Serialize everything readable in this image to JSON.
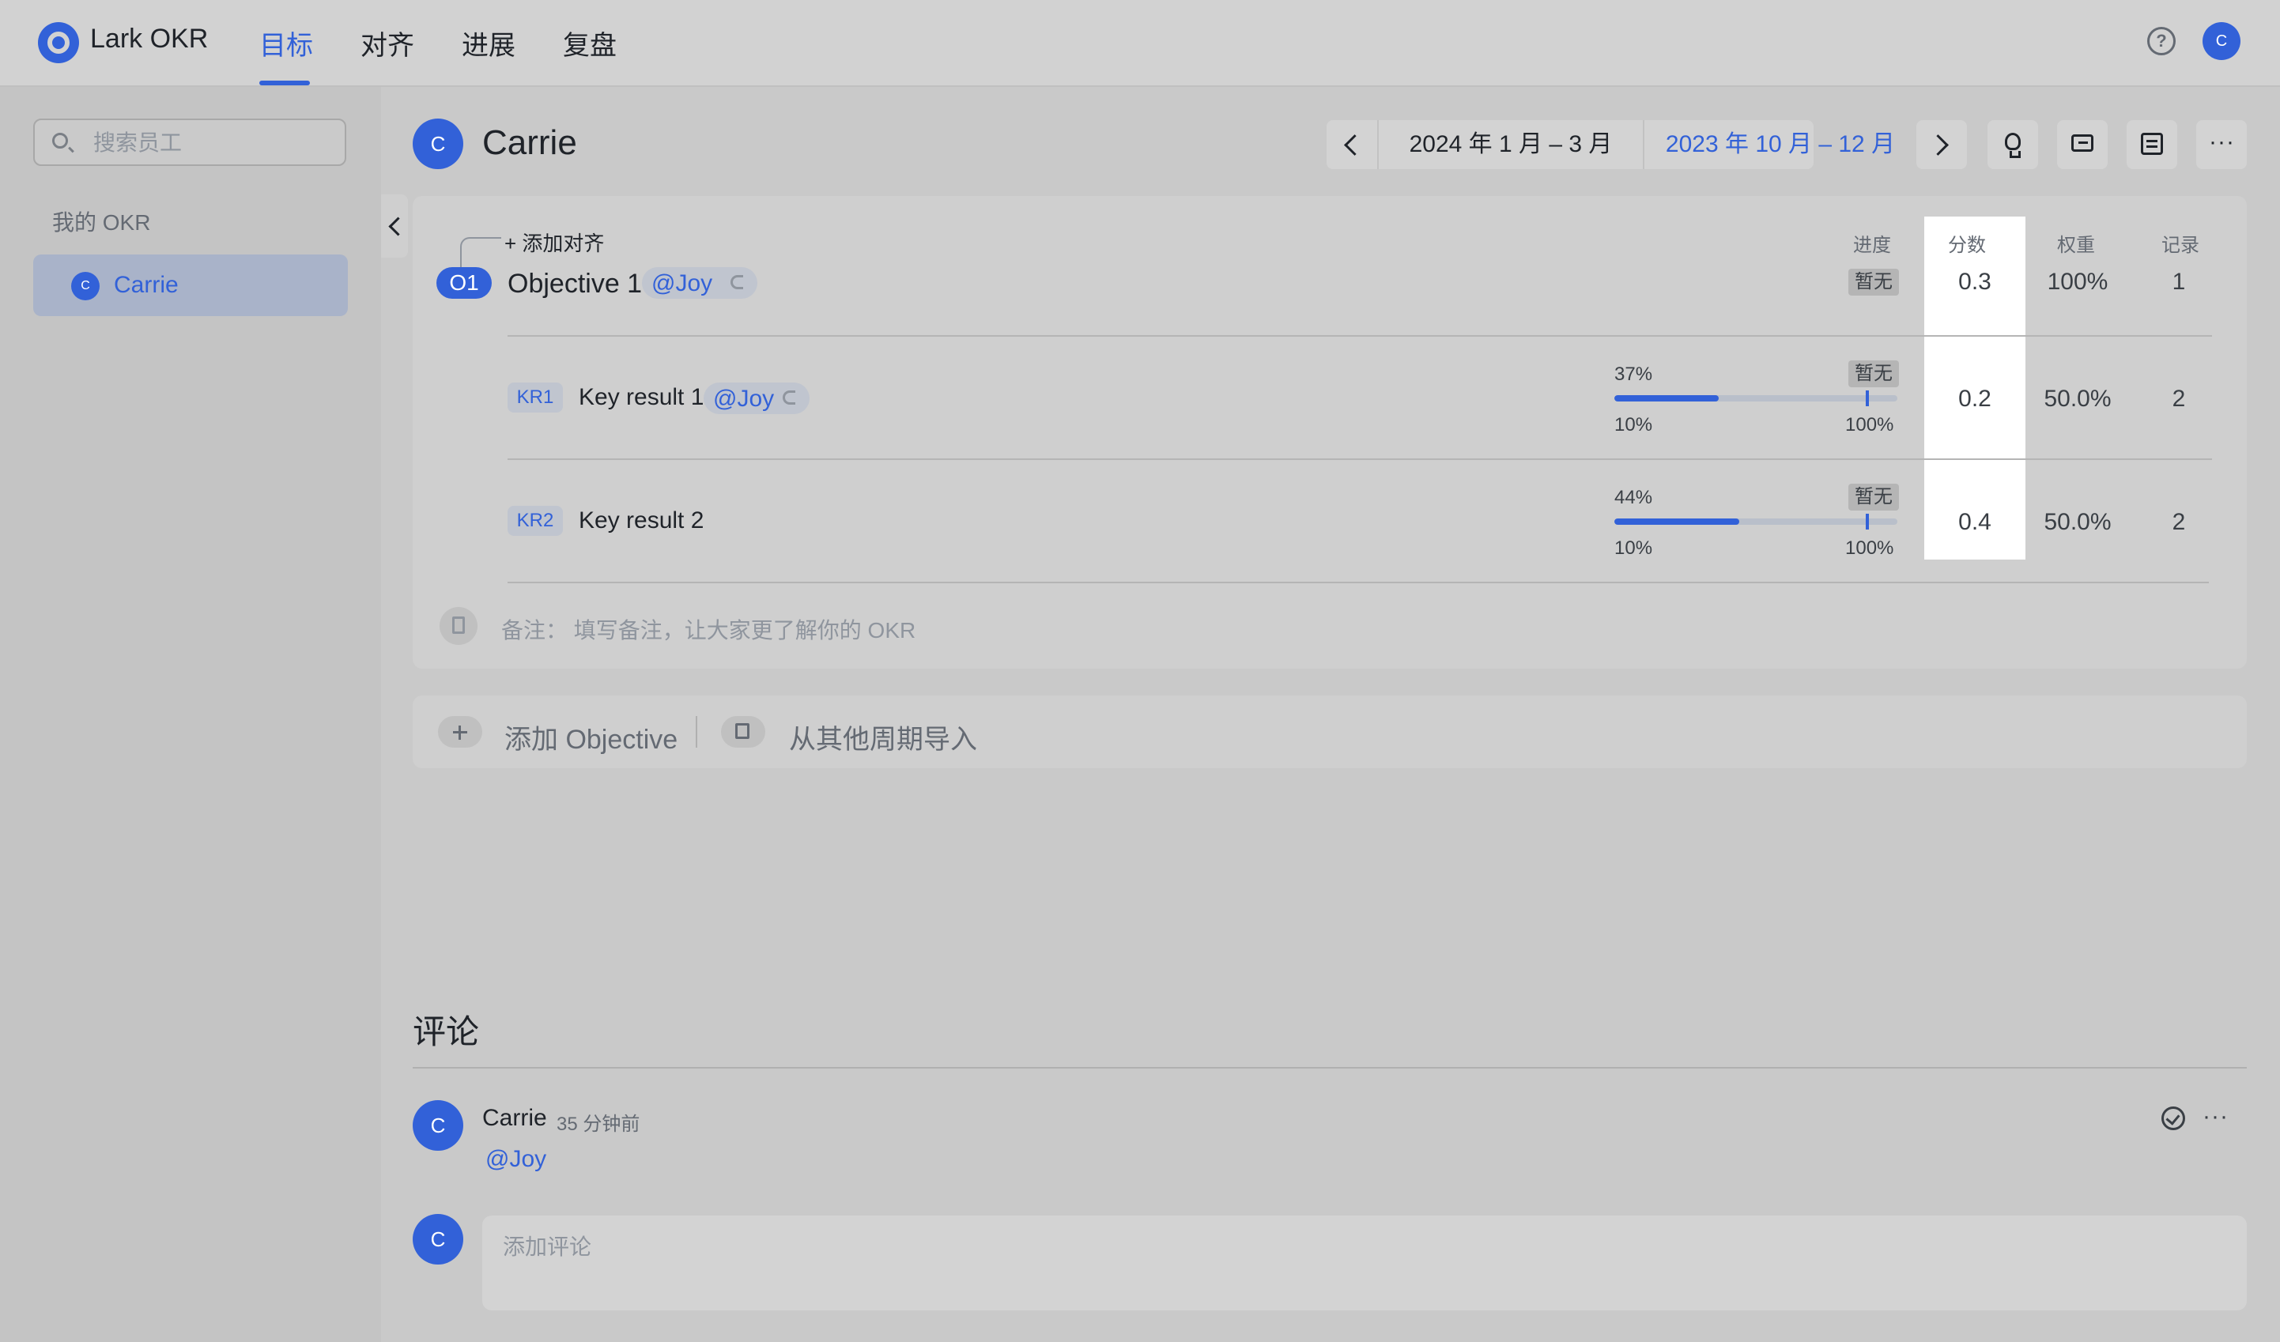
{
  "app": {
    "brand": "Lark OKR"
  },
  "nav": {
    "tabs": [
      "目标",
      "对齐",
      "进展",
      "复盘"
    ],
    "active": "目标"
  },
  "header": {
    "avatar_initial": "C"
  },
  "sidebar": {
    "search_placeholder": "搜索员工",
    "section_label": "我的 OKR",
    "items": [
      {
        "label": "Carrie",
        "initial": "C",
        "selected": true
      }
    ]
  },
  "user": {
    "name": "Carrie",
    "initial": "C"
  },
  "period": {
    "current": "2024 年 1 月 – 3 月",
    "previous": "2023 年 10 月 – 12 月"
  },
  "columns": {
    "progress": "进度",
    "score": "分数",
    "weight": "权重",
    "records": "记录"
  },
  "objective": {
    "add_align": "+ 添加对齐",
    "badge": "O1",
    "title": "Objective 1",
    "mention": "@Joy",
    "status": "暂无",
    "score": "0.3",
    "weight": "100%",
    "records": "1"
  },
  "key_results": [
    {
      "badge": "KR1",
      "title": "Key result 1",
      "mention": "@Joy",
      "progress_pct": "37%",
      "progress": 0.37,
      "status": "暂无",
      "range_start": "10%",
      "range_end": "100%",
      "score": "0.2",
      "weight": "50.0%",
      "records": "2"
    },
    {
      "badge": "KR2",
      "title": "Key result 2",
      "mention": "",
      "progress_pct": "44%",
      "progress": 0.44,
      "status": "暂无",
      "range_start": "10%",
      "range_end": "100%",
      "score": "0.4",
      "weight": "50.0%",
      "records": "2"
    }
  ],
  "note": {
    "text": "备注：  填写备注，让大家更了解你的 OKR"
  },
  "actions": {
    "add_objective": "添加 Objective",
    "import": "从其他周期导入"
  },
  "comments": {
    "title": "评论",
    "items": [
      {
        "author": "Carrie",
        "initial": "C",
        "time": "35 分钟前",
        "body": "@Joy"
      }
    ],
    "input_placeholder": "添加评论",
    "input_avatar_initial": "C"
  },
  "colors": {
    "accent": "#3261d8",
    "score_column_bg": "#ffffff"
  }
}
